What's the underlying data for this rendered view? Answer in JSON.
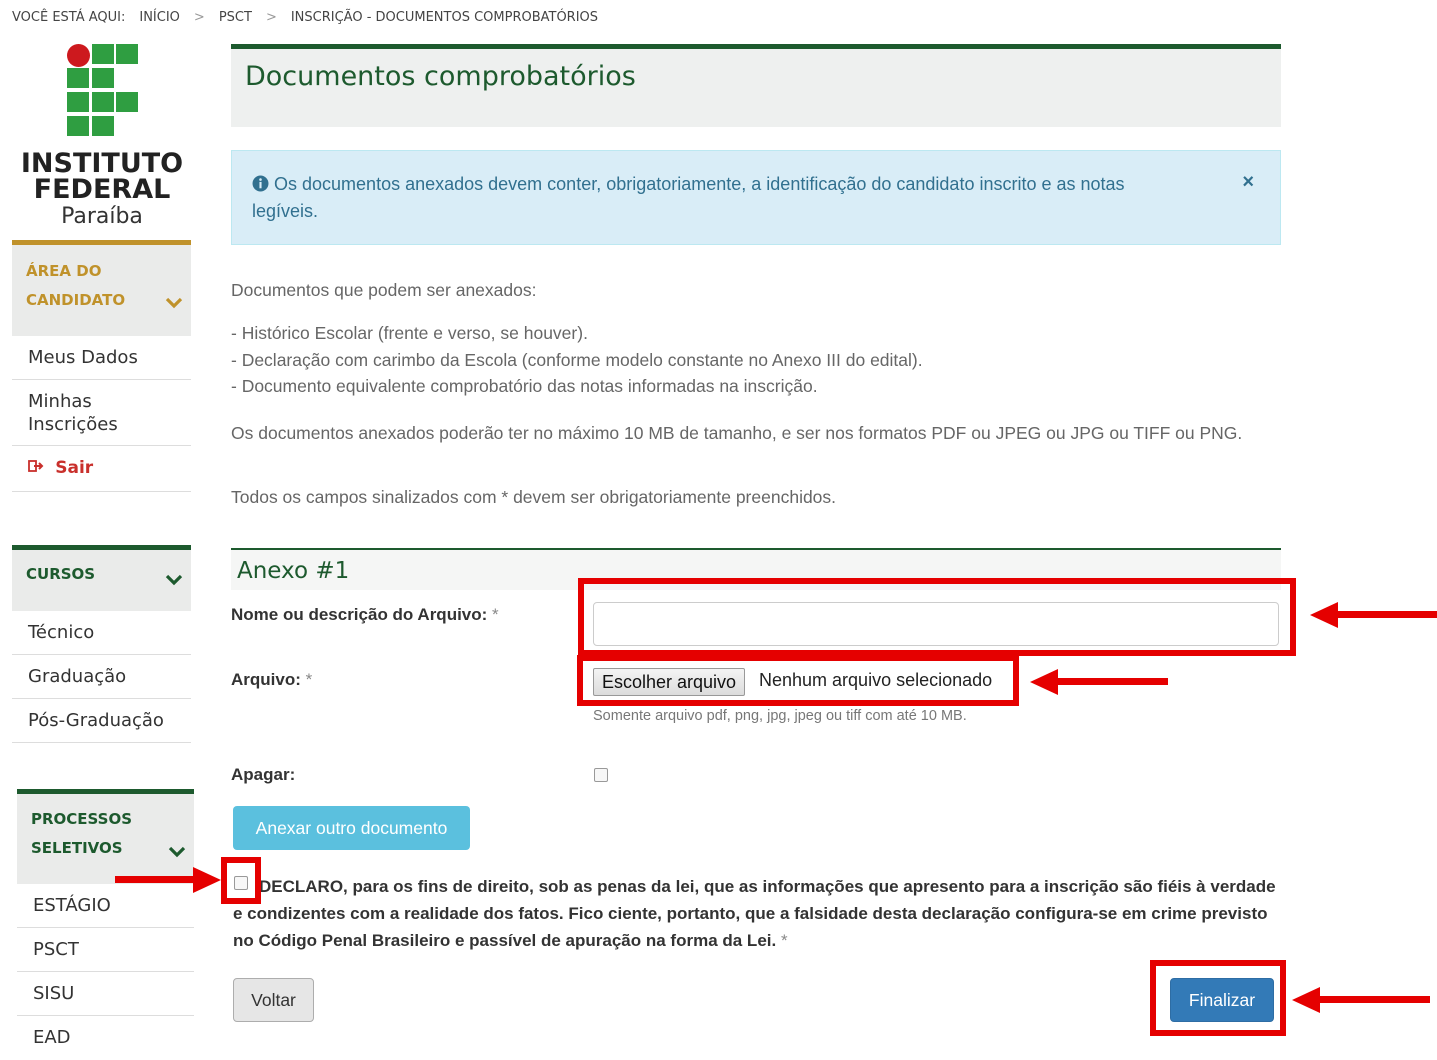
{
  "colors": {
    "brand_green": "#2f9e41",
    "brand_red": "#cd191e",
    "dark_green": "#1d5a2e",
    "gold": "#c0922b",
    "annotation_red": "#e50000",
    "primary": "#337ab7",
    "info": "#5bc0de"
  },
  "breadcrumb": {
    "prefix": "VOCÊ ESTÁ AQUI:",
    "items": [
      "INÍCIO",
      "PSCT",
      "INSCRIÇÃO - DOCUMENTOS COMPROBATÓRIOS"
    ],
    "separator": ">"
  },
  "logo": {
    "line1": "INSTITUTO",
    "line2": "FEDERAL",
    "line3": "Paraíba"
  },
  "sidebar": {
    "candidate": {
      "title_line1": "ÁREA DO",
      "title_line2": "CANDIDATO",
      "items": [
        "Meus Dados",
        "Minhas",
        "Inscrições"
      ],
      "logout": "Sair"
    },
    "courses": {
      "title": "CURSOS",
      "items": [
        "Técnico",
        "Graduação",
        "Pós-Graduação"
      ]
    },
    "processes": {
      "title_line1": "PROCESSOS",
      "title_line2": "SELETIVOS",
      "items": [
        "ESTÁGIO",
        "PSCT",
        "SISU",
        "EAD"
      ]
    }
  },
  "page": {
    "title": "Documentos comprobatórios"
  },
  "alert": {
    "icon": "info-circle-icon",
    "text": "Os documentos anexados devem conter, obrigatoriamente, a identificação do candidato inscrito e as notas legíveis.",
    "close": "×"
  },
  "info": {
    "intro": "Documentos que podem ser anexados:",
    "docs": [
      "- Histórico Escolar (frente e verso, se houver).",
      "- Declaração com carimbo da Escola (conforme modelo constante no Anexo III do edital).",
      "- Documento equivalente comprobatório das notas informadas na inscrição."
    ],
    "limits": "Os documentos anexados poderão ter no máximo 10 MB de tamanho, e ser nos formatos PDF ou JPEG ou JPG ou TIFF ou PNG.",
    "required_note": "Todos os campos sinalizados com * devem ser obrigatoriamente preenchidos."
  },
  "form": {
    "section_title": "Anexo #1",
    "name_label": "Nome ou descrição do Arquivo:",
    "file_label": "Arquivo:",
    "required_mark": "*",
    "file_button": "Escolher arquivo",
    "file_status": "Nenhum arquivo selecionado",
    "file_help": "Somente arquivo pdf, png, jpg, jpeg ou tiff com até 10 MB.",
    "delete_label": "Apagar:",
    "add_button": "Anexar outro documento",
    "declaration": "DECLARO, para os fins de direito, sob as penas da lei, que as informações que apresento para a inscrição são fiéis à verdade e condizentes com a realidade dos fatos. Fico ciente, portanto, que a falsidade desta declaração configura-se em crime previsto no Código Penal Brasileiro e passível de apuração na forma da Lei.",
    "back_button": "Voltar",
    "finish_button": "Finalizar"
  }
}
